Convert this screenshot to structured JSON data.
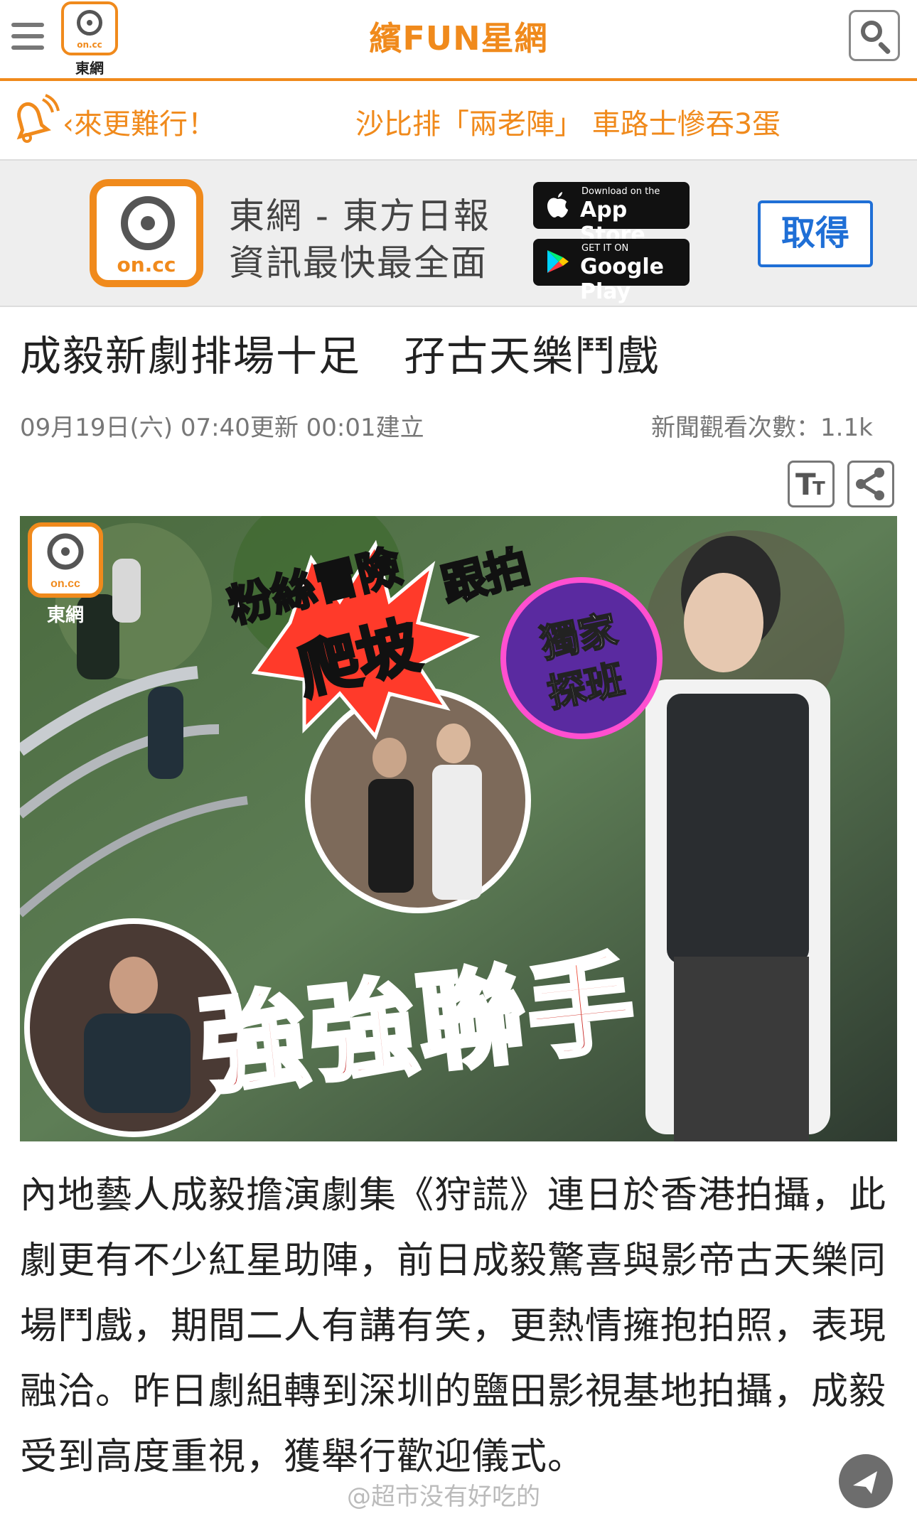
{
  "header": {
    "site_title": "繽FUN星網",
    "logo_oncc": "on.cc",
    "logo_brand": "東網"
  },
  "ticker": {
    "items": [
      "‹來更難行！",
      "沙比排「兩老陣」 車路士慘吞3蛋"
    ]
  },
  "app_banner": {
    "logo_text": "on.cc",
    "line1": "東網 - 東方日報",
    "line2": "資訊最快最全面",
    "appstore_small": "Download on the",
    "appstore_big": "App Store",
    "gplay_small": "GET IT ON",
    "gplay_big": "Google Play",
    "get_button": "取得"
  },
  "article": {
    "headline": "成毅新劇排場十足　孖古天樂鬥戲",
    "meta_time": "09月19日(六) 07:40更新 00:01建立",
    "meta_views": "新聞觀看次數：1.1k",
    "image": {
      "logo_oncc": "on.cc",
      "logo_brand": "東網",
      "caption_top": "粉絲冒險",
      "caption_climb": "爬坡",
      "caption_follow": "跟拍",
      "badge_line1": "獨家",
      "badge_line2": "探班",
      "caption_big": "強強聯手"
    },
    "body": "內地藝人成毅擔演劇集《狩謊》連日於香港拍攝，此劇更有不少紅星助陣，前日成毅驚喜與影帝古天樂同場鬥戲，期間二人有講有笑，更熱情擁抱拍照，表現融洽。昨日劇組轉到深圳的鹽田影視基地拍攝，成毅受到高度重視，獲舉行歡迎儀式。"
  },
  "watermark": "@超市没有好吃的",
  "colors": {
    "accent": "#f08a1c",
    "link_blue": "#1f6fd6"
  }
}
